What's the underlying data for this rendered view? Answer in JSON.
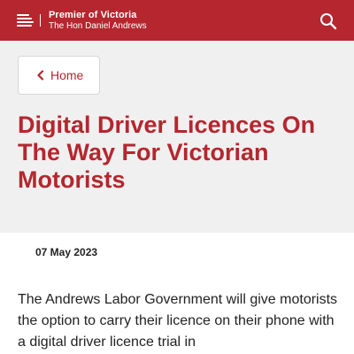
{
  "header": {
    "title": "Premier of Victoria",
    "subtitle": "The Hon Daniel Andrews",
    "menu_icon": "menu-icon",
    "search_icon": "search-icon",
    "color": "#b5262e"
  },
  "breadcrumb": {
    "home_label": "Home",
    "icon": "chevron-left-icon"
  },
  "article": {
    "title": "Digital Driver Licences On The Way For Victorian Motorists",
    "date": "07 May 2023",
    "body": "The Andrews Labor Government will give motorists the option to carry their licence on their phone with a digital driver licence trial in"
  }
}
